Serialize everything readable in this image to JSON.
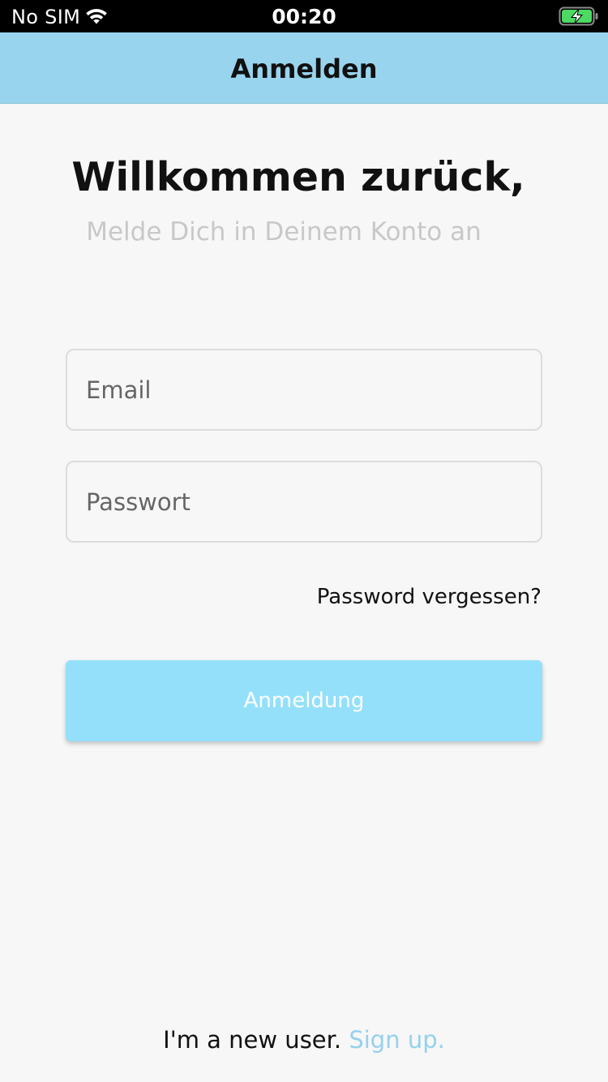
{
  "status_bar": {
    "carrier": "No SIM",
    "time": "00:20",
    "wifi_icon": "wifi-icon",
    "battery_icon": "battery-charging-icon",
    "battery_color": "#4cd964"
  },
  "nav": {
    "title": "Anmelden",
    "background": "#99d4ee"
  },
  "welcome": {
    "title": "Willkommen zurück,",
    "subtitle": "Melde Dich in Deinem Konto an"
  },
  "form": {
    "email_placeholder": "Email",
    "email_value": "",
    "password_placeholder": "Passwort",
    "password_value": "",
    "forgot_label": "Password vergessen?",
    "submit_label": "Anmeldung",
    "submit_color": "#94e0fb"
  },
  "footer": {
    "prompt": "I'm a new user.",
    "signup_label": "Sign up.",
    "signup_color": "#94d2ec"
  }
}
